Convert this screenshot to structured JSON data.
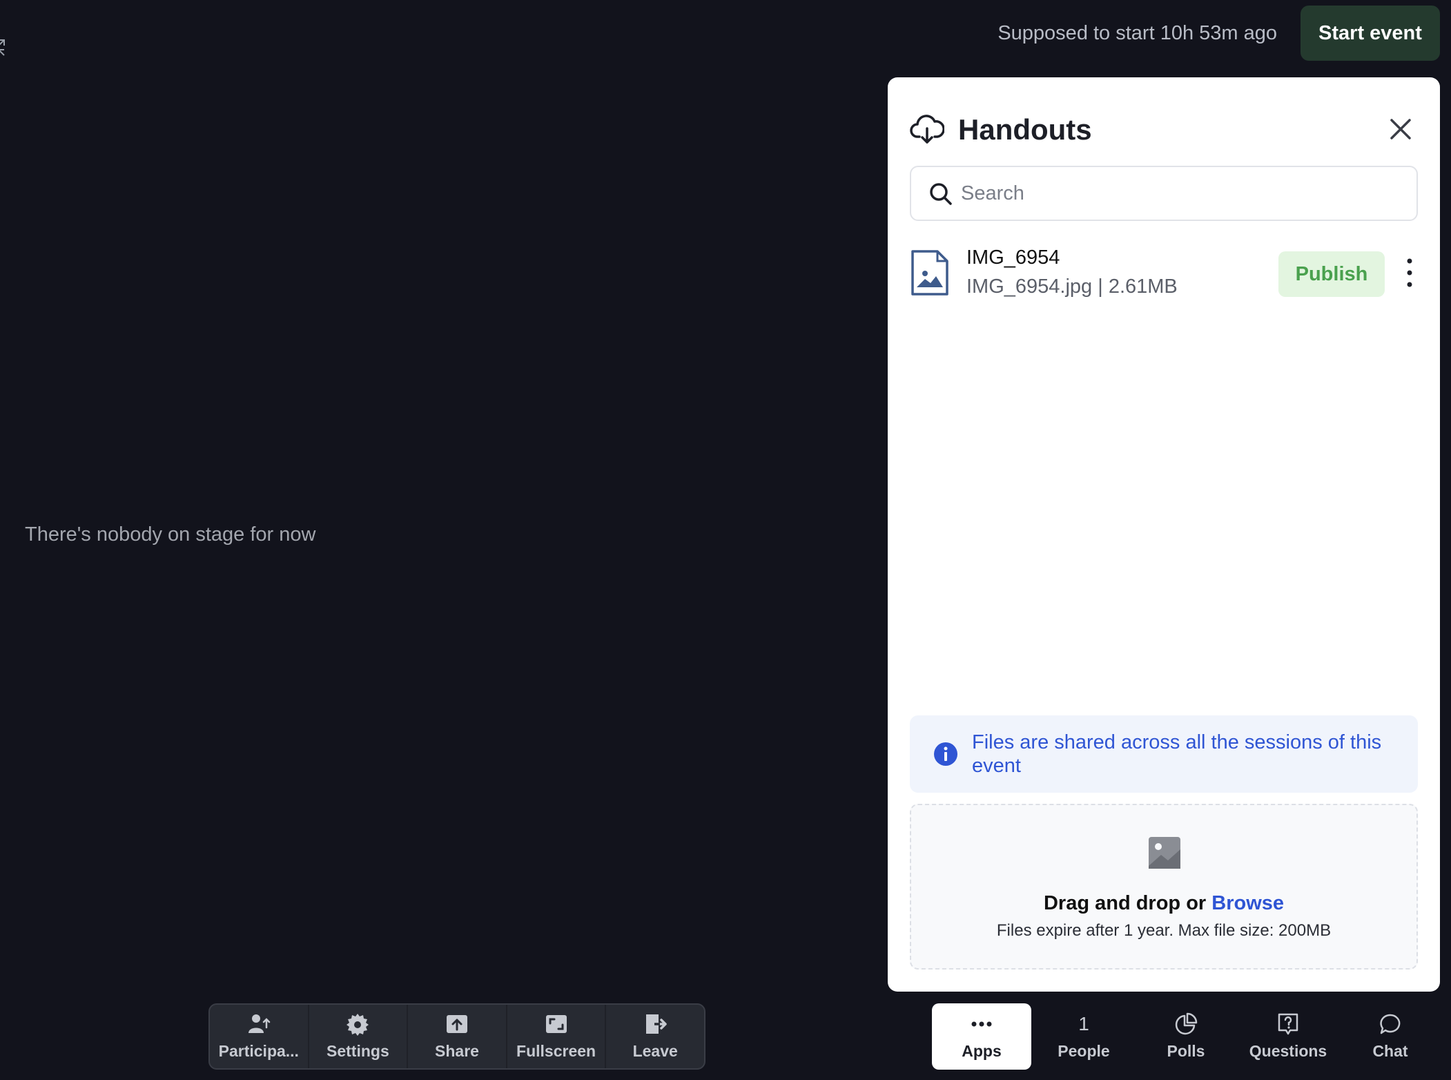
{
  "topbar": {
    "status": "Supposed to start 10h 53m ago",
    "start_button": "Start event"
  },
  "stage": {
    "empty_message": "There's nobody on stage for now"
  },
  "handouts": {
    "title": "Handouts",
    "search_placeholder": "Search",
    "files": [
      {
        "name": "IMG_6954",
        "meta": "IMG_6954.jpg | 2.61MB",
        "action": "Publish"
      }
    ],
    "info": "Files are shared across all the sessions of this event",
    "dropzone": {
      "prefix": "Drag and drop or ",
      "browse": "Browse",
      "note": "Files expire after 1 year. Max file size: 200MB"
    }
  },
  "toolbar": {
    "items": [
      {
        "label": "Participa...",
        "icon": "participants-icon"
      },
      {
        "label": "Settings",
        "icon": "gear-icon"
      },
      {
        "label": "Share",
        "icon": "share-icon"
      },
      {
        "label": "Fullscreen",
        "icon": "fullscreen-icon"
      },
      {
        "label": "Leave",
        "icon": "leave-icon"
      }
    ]
  },
  "dock": {
    "items": [
      {
        "label": "Apps",
        "icon": "more-dots-icon",
        "active": true
      },
      {
        "label": "People",
        "count": "1"
      },
      {
        "label": "Polls",
        "icon": "pie-chart-icon"
      },
      {
        "label": "Questions",
        "icon": "question-icon"
      },
      {
        "label": "Chat",
        "icon": "chat-icon"
      }
    ]
  },
  "colors": {
    "background": "#12131c",
    "start_button": "#243a2e",
    "publish_bg": "#e3f5e0",
    "publish_text": "#4aa14e",
    "link": "#2f55d4",
    "info_bg": "#f0f4fc"
  }
}
